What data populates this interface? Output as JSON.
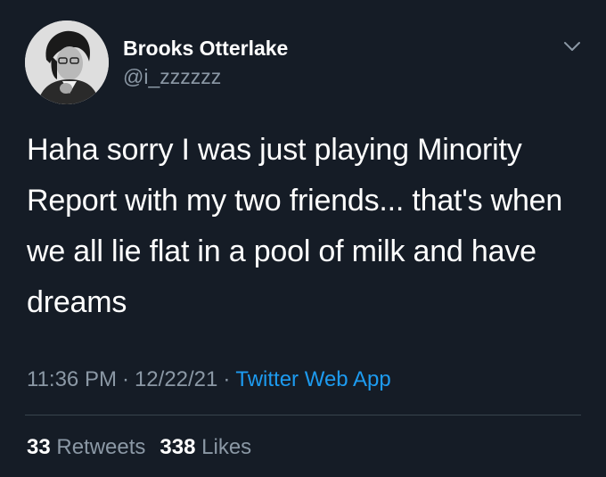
{
  "user": {
    "display_name": "Brooks Otterlake",
    "handle": "@i_zzzzzz",
    "avatar_icon": "profile-photo"
  },
  "tweet": {
    "text": "Haha sorry I was just playing Minority Report with my two friends... that's when we all lie flat in a pool of milk and have dreams",
    "time": "11:36 PM",
    "date": "12/22/21",
    "separator": "·",
    "source": "Twitter Web App"
  },
  "stats": {
    "retweets_count": "33",
    "retweets_label": "Retweets",
    "likes_count": "338",
    "likes_label": "Likes"
  },
  "colors": {
    "background": "#151c26",
    "muted_text": "#8b98a5",
    "link": "#1d9bf0",
    "divider": "#38444d"
  },
  "icons": {
    "menu": "chevron-down-icon"
  }
}
